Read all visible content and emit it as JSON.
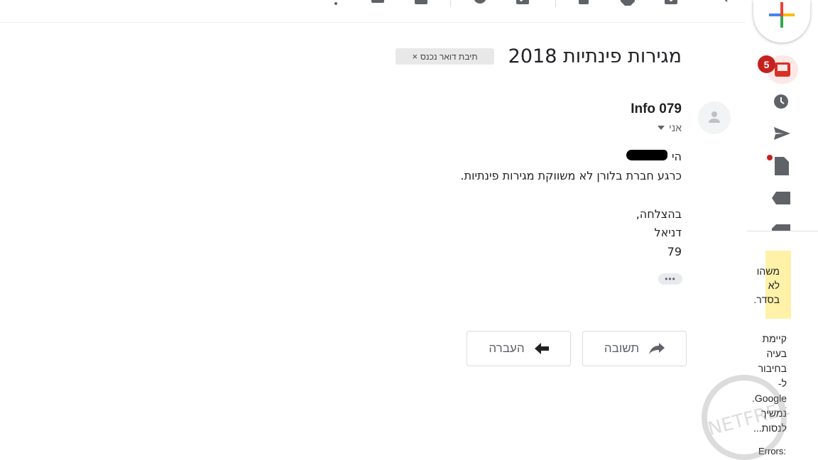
{
  "subject": "מגירות פינתיות 2018",
  "label_chip": {
    "text": "תיבת דואר נכנס",
    "remove": "×"
  },
  "sender": {
    "name": "Info 079",
    "to_label": "אני"
  },
  "body": {
    "greeting": "הי",
    "line1": "כרגע חברת בלורן לא משווקת מגירות פינתיות.",
    "closing": "בהצלחה,",
    "signature_name": "דניאל",
    "signature_num": "79"
  },
  "actions": {
    "reply": "תשובה",
    "forward": "העברה"
  },
  "sidebar": {
    "inbox_badge": "5",
    "icons": [
      "inbox-icon",
      "snoozed-clock-icon",
      "sent-icon",
      "draft-icon",
      "label-icon",
      "label-icon"
    ]
  },
  "notice": {
    "text": "משהו לא בסדר.",
    "detail": "קיימת בעיה בחיבור ל-Google. נמשיך לנסות...",
    "errors": "Errors:"
  },
  "watermark_text": "NETFREE",
  "colors": {
    "accent_red": "#c5221f",
    "highlight": "#fff2a8",
    "icon_gray": "#5f6368"
  }
}
